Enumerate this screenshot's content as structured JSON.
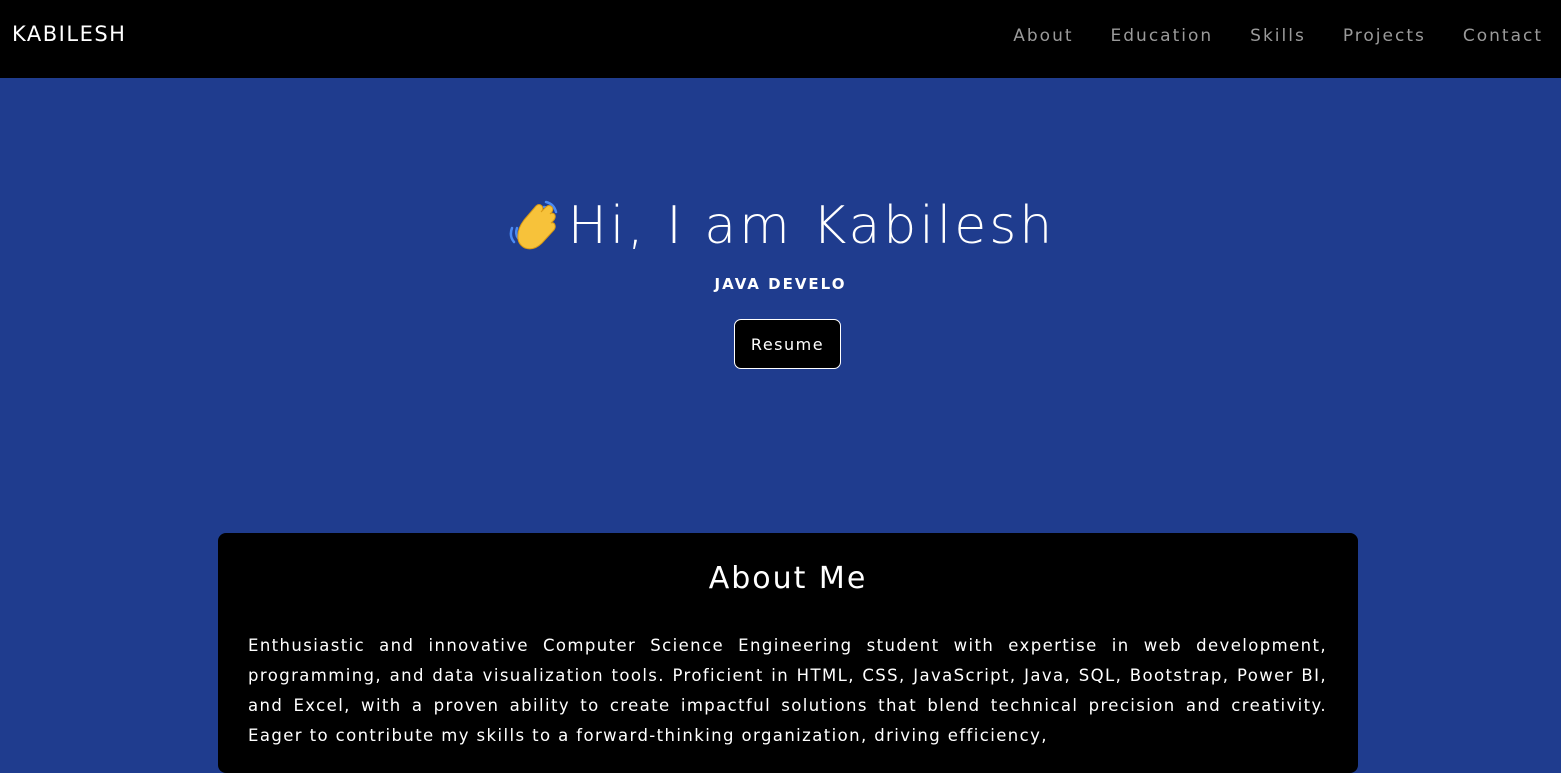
{
  "navbar": {
    "brand": "KABILESH",
    "links": [
      "About",
      "Education",
      "Skills",
      "Projects",
      "Contact"
    ]
  },
  "hero": {
    "wave_icon": "waving-hand-icon",
    "heading": "Hi, I am Kabilesh",
    "subtitle": "JAVA DEVELO",
    "resume_label": "Resume"
  },
  "about": {
    "title": "About Me",
    "text": "Enthusiastic and innovative Computer Science Engineering student with expertise in web development, programming, and data visualization tools. Proficient in HTML, CSS, JavaScript, Java, SQL, Bootstrap, Power BI, and Excel, with a proven ability to create impactful solutions that blend technical precision and creativity. Eager to contribute my skills to a forward-thinking organization, driving efficiency,"
  },
  "colors": {
    "background": "#1f3c8e",
    "navbar": "#000000",
    "nav_link": "#9a9a9a",
    "card": "#000000",
    "text": "#ffffff",
    "wave": "#f7c23a"
  }
}
